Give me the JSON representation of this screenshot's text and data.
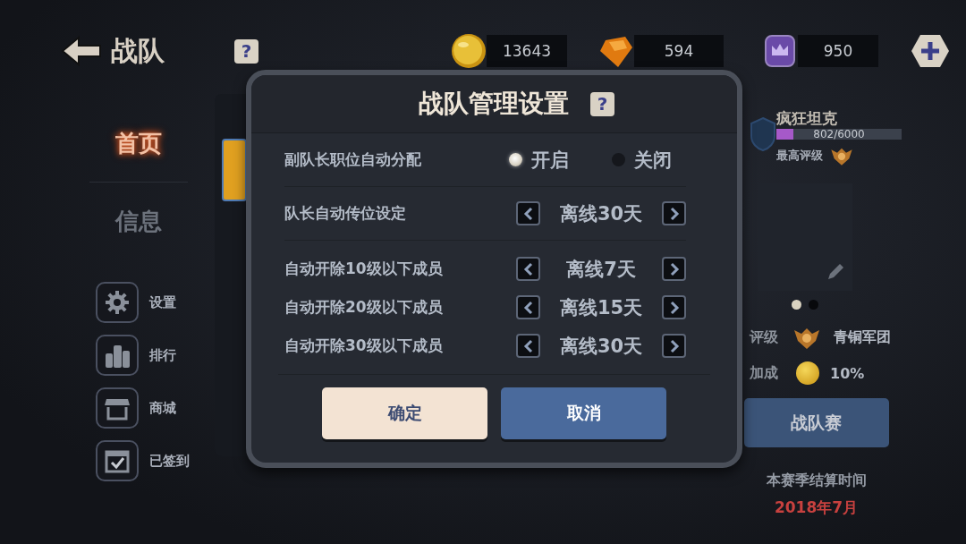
{
  "header": {
    "title": "战队",
    "help": "?"
  },
  "currencies": [
    {
      "kind": "coin",
      "amount": "13643"
    },
    {
      "kind": "gem",
      "amount": "594"
    },
    {
      "kind": "crown",
      "amount": "950"
    }
  ],
  "sidebar": {
    "tabs": [
      {
        "label": "首页",
        "selected": true
      },
      {
        "label": "信息",
        "selected": false
      }
    ],
    "shortcuts": [
      {
        "kind": "gear",
        "label": "设置"
      },
      {
        "kind": "podium",
        "label": "排行"
      },
      {
        "kind": "shop",
        "label": "商城"
      },
      {
        "kind": "calendar",
        "label": "已签到"
      }
    ]
  },
  "team": {
    "name": "疯狂坦克",
    "exp": "802/6000",
    "level": 0.134,
    "best_rank_label": "最高评级",
    "page_dots": [
      {
        "selected": true
      },
      {
        "selected": false
      }
    ],
    "rank_label": "评级",
    "rank_value": "青铜军团",
    "bonus_label": "加成",
    "bonus_value": "10%",
    "match_button": "战队赛",
    "season_label": "本赛季结算时间",
    "season_date": "2018年7月"
  },
  "dialog": {
    "title": "战队管理设置",
    "help": "?",
    "settings": [
      {
        "kind": "radio",
        "label": "副队长职位自动分配",
        "options": [
          {
            "label": "开启",
            "selected": true
          },
          {
            "label": "关闭",
            "selected": false
          }
        ]
      },
      {
        "kind": "stepper",
        "label": "队长自动传位设定",
        "value": "离线30天"
      },
      {
        "kind": "stepper",
        "label": "自动开除10级以下成员",
        "value": "离线7天"
      },
      {
        "kind": "stepper",
        "label": "自动开除20级以下成员",
        "value": "离线15天"
      },
      {
        "kind": "stepper",
        "label": "自动开除30级以下成员",
        "value": "离线30天"
      }
    ],
    "buttons": [
      {
        "kind": "confirm",
        "label": "确定"
      },
      {
        "kind": "cancel",
        "label": "取消"
      }
    ]
  }
}
